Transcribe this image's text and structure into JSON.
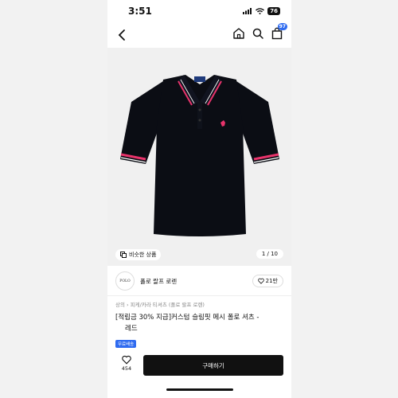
{
  "status": {
    "time": "3:51",
    "battery": "76"
  },
  "nav": {
    "cart_count": "97"
  },
  "gallery": {
    "similar_label": "비슷한 상품",
    "page_indicator": "1 / 10"
  },
  "brand": {
    "logo_text": "POLO",
    "name": "폴로 랄프 로렌",
    "likes": "21만"
  },
  "breadcrumb": "상의 › 피케/카라 티셔츠 (폴로 랄프 로렌)",
  "product": {
    "title_line1": "[적립금 30% 지급]커스텀 슬림핏 메시 폴로 셔츠 -",
    "title_line2": "레드",
    "tag": "무료배송"
  },
  "bottom": {
    "heart_count": "454",
    "buy_label": "구매하기"
  },
  "colors": {
    "accent": "#2f6bf0",
    "shirt": "#0b0d14",
    "trim": "#e8336b"
  }
}
